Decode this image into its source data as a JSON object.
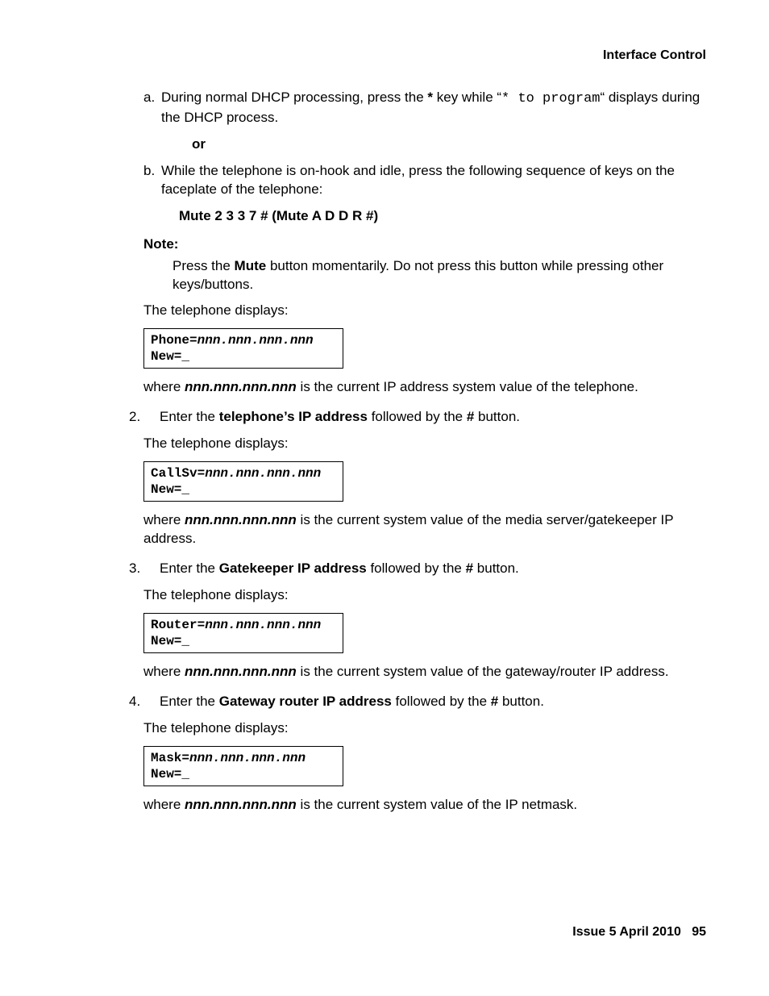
{
  "header": {
    "title": "Interface Control"
  },
  "stepA": {
    "marker": "a.",
    "text_pre": "During normal DHCP processing, press the ",
    "star": "*",
    "text_mid": " key while “",
    "code": "* to program",
    "text_post": "“ displays during the DHCP process.",
    "or": "or"
  },
  "stepB": {
    "marker": "b.",
    "text": "While the telephone is on-hook and idle, press the following sequence of keys on the faceplate of the telephone:",
    "mute_seq": "Mute 2 3 3 7 # (Mute A D D R #)"
  },
  "note": {
    "label": "Note:",
    "body_pre": "Press the ",
    "mute": "Mute",
    "body_post": " button momentarily. Do not press this button while pressing other keys/buttons."
  },
  "displays_label": "The telephone displays:",
  "box1": {
    "l1a": "Phone=",
    "l1b": "nnn.nnn.nnn.nnn",
    "l2": "New=_"
  },
  "where1": {
    "pre": "where ",
    "ip": "nnn.nnn.nnn.nnn",
    "post": " is the current IP address system value of the telephone."
  },
  "step2": {
    "marker": "2.",
    "pre": "Enter the ",
    "bold": "telephone’s IP address",
    "mid": " followed by the ",
    "hash": "#",
    "post": " button."
  },
  "box2": {
    "l1a": "CallSv=",
    "l1b": "nnn.nnn.nnn.nnn",
    "l2": "New=_"
  },
  "where2": {
    "pre": "where ",
    "ip": "nnn.nnn.nnn.nnn",
    "post": " is the current system value of the media server/gatekeeper IP address."
  },
  "step3": {
    "marker": "3.",
    "pre": "Enter the ",
    "bold": "Gatekeeper IP address",
    "mid": " followed by the ",
    "hash": "#",
    "post": " button."
  },
  "box3": {
    "l1a": "Router=",
    "l1b": "nnn.nnn.nnn.nnn",
    "l2": "New=_"
  },
  "where3": {
    "pre": "where ",
    "ip": "nnn.nnn.nnn.nnn",
    "post": " is the current system value of the gateway/router IP address."
  },
  "step4": {
    "marker": "4.",
    "pre": "Enter the ",
    "bold": "Gateway router IP address",
    "mid": " followed by the ",
    "hash": "#",
    "post": " button."
  },
  "box4": {
    "l1a": "Mask=",
    "l1b": "nnn.nnn.nnn.nnn",
    "l2": "New=_"
  },
  "where4": {
    "pre": "where ",
    "ip": "nnn.nnn.nnn.nnn",
    "post": " is the current system value of the IP netmask."
  },
  "footer": {
    "issue": "Issue 5   April 2010",
    "page": "95"
  }
}
